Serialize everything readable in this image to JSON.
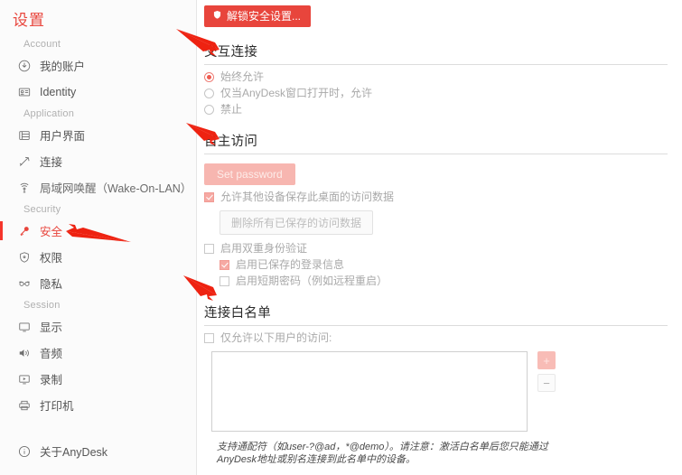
{
  "sidebar": {
    "title": "设置",
    "groups": [
      {
        "label": "Account",
        "items": [
          {
            "label": "我的账户",
            "icon": "account-circle-icon",
            "active": false
          },
          {
            "label": "Identity",
            "icon": "id-card-icon",
            "active": false
          }
        ]
      },
      {
        "label": "Application",
        "items": [
          {
            "label": "用户界面",
            "icon": "window-layout-icon",
            "active": false
          },
          {
            "label": "连接",
            "icon": "connection-icon",
            "active": false
          },
          {
            "label": "局域网唤醒（Wake-On-LAN）",
            "icon": "wifi-broadcast-icon",
            "active": false
          }
        ]
      },
      {
        "label": "Security",
        "items": [
          {
            "label": "安全",
            "icon": "key-icon",
            "active": true
          },
          {
            "label": "权限",
            "icon": "shield-icon",
            "active": false
          },
          {
            "label": "隐私",
            "icon": "glasses-icon",
            "active": false
          }
        ]
      },
      {
        "label": "Session",
        "items": [
          {
            "label": "显示",
            "icon": "monitor-icon",
            "active": false
          },
          {
            "label": "音频",
            "icon": "speaker-icon",
            "active": false
          },
          {
            "label": "录制",
            "icon": "record-screen-icon",
            "active": false
          },
          {
            "label": "打印机",
            "icon": "printer-icon",
            "active": false
          }
        ]
      }
    ],
    "footer_item": {
      "label": "关于AnyDesk",
      "icon": "info-circle-icon"
    }
  },
  "content": {
    "unlock_button": {
      "label": "解锁安全设置...",
      "icon": "shield-icon"
    },
    "sections": [
      {
        "heading": "交互连接",
        "radios": [
          {
            "label": "始终允许",
            "selected": true
          },
          {
            "label": "仅当AnyDesk窗口打开时，允许",
            "selected": false
          },
          {
            "label": "禁止",
            "selected": false
          }
        ]
      },
      {
        "heading": "自主访问",
        "set_password_label": "Set password",
        "checkbox_allow_save": {
          "label": "允许其他设备保存此桌面的访问数据",
          "checked": true
        },
        "clear_button_label": "删除所有已保存的访问数据",
        "checkbox_two_factor": {
          "label": "启用双重身份验证",
          "checked": false
        },
        "checkbox_saved_login": {
          "label": "启用已保存的登录信息",
          "checked": true
        },
        "checkbox_temp_password": {
          "label": "启用短期密码（例如远程重启）",
          "checked": false
        }
      },
      {
        "heading": "连接白名单",
        "checkbox_only_allow": {
          "label": "仅允许以下用户的访问:",
          "checked": false
        },
        "whitelist_value": "",
        "add_button_label": "+",
        "remove_button_label": "−",
        "note": "支持通配符（如user-?@ad，*@demo）。请注意：激活白名单后您只能通过AnyDesk地址或别名连接到此名单中的设备。"
      }
    ]
  },
  "annotations": {
    "arrow_color": "#ee2211",
    "arrows": [
      {
        "name": "arrow-to-interactive-connection"
      },
      {
        "name": "arrow-to-unattended-access"
      },
      {
        "name": "arrow-to-security-nav"
      },
      {
        "name": "arrow-to-whitelist"
      }
    ]
  },
  "colors": {
    "accent": "#e8453c",
    "sidebar_bg": "#fbfbfb",
    "text": "#3c3c3c",
    "muted": "#a9a9a9"
  }
}
